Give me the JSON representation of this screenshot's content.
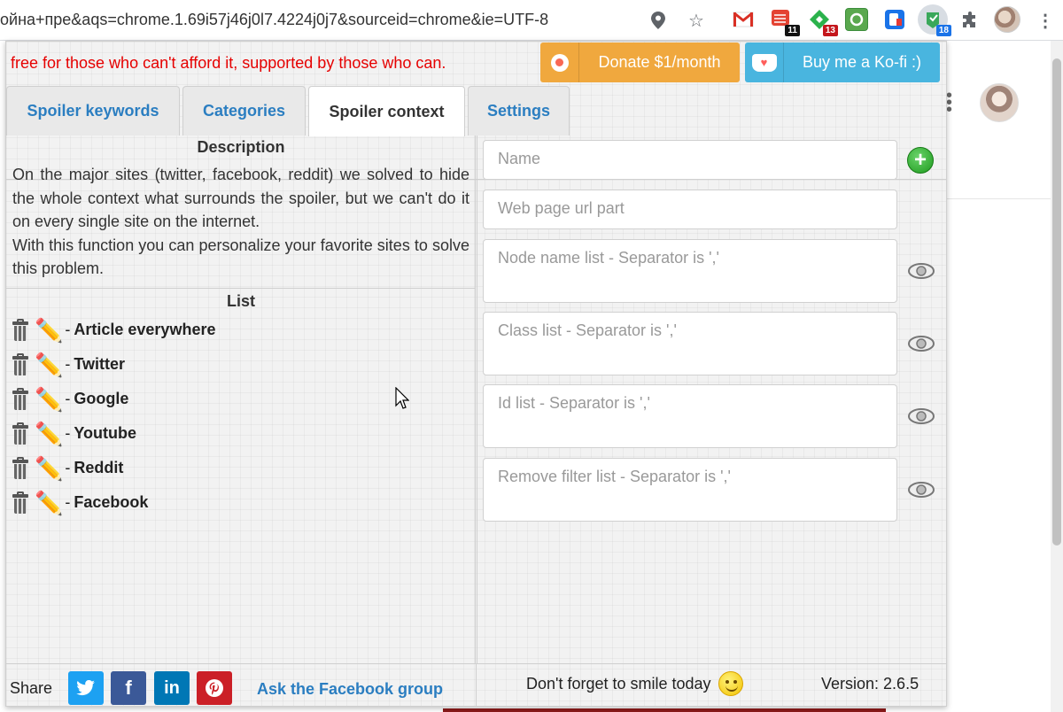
{
  "browser": {
    "url": "ойна+пре&aqs=chrome.1.69i57j46j0l7.4224j0j7&sourceid=chrome&ie=UTF-8",
    "icons": [
      "location-icon",
      "star-icon",
      "gmail-icon",
      "todoist-icon",
      "feedly-icon",
      "refresh-icon",
      "tab-icon",
      "spoiler-icon",
      "extensions-icon",
      "avatar",
      "menu-icon"
    ],
    "badges": {
      "todoist": "11",
      "feedly": "13",
      "spoiler": "18"
    }
  },
  "popup": {
    "slogan": "free for those who can't afford it, supported by those who can.",
    "donate_patreon": "Donate $1/month",
    "donate_kofi": "Buy me a Ko-fi :)",
    "colors": {
      "slogan": "#e60000",
      "patreon": "#f0a83e",
      "kofi": "#49b5df",
      "tab_link": "#2b7ec1"
    },
    "tabs": [
      {
        "label": "Spoiler keywords",
        "active": false
      },
      {
        "label": "Categories",
        "active": false
      },
      {
        "label": "Spoiler context",
        "active": true
      },
      {
        "label": "Settings",
        "active": false
      }
    ],
    "description": {
      "title": "Description",
      "text1": "On the major sites (twitter, facebook, reddit) we solved to hide the whole context what surrounds the spoiler, but we can't do it on every single site on the internet.",
      "text2": "With this function you can personalize your favorite sites to solve this problem."
    },
    "list": {
      "title": "List",
      "dash": "-",
      "items": [
        "Article everywhere",
        "Twitter",
        "Google",
        "Youtube",
        "Reddit",
        "Facebook"
      ]
    },
    "form": {
      "name": "Name",
      "url": "Web page url part",
      "node": "Node name list - Separator is ','",
      "class": "Class list - Separator is ','",
      "id": "Id list  - Separator is ','",
      "remove": "Remove filter list - Separator is ','"
    },
    "footer": {
      "share": "Share",
      "fb_group": "Ask the Facebook group",
      "smile": "Don't forget to smile today",
      "version": "Version: 2.6.5",
      "social": {
        "twitter": "t",
        "facebook": "f",
        "linkedin": "in",
        "pinterest": "P"
      }
    }
  }
}
